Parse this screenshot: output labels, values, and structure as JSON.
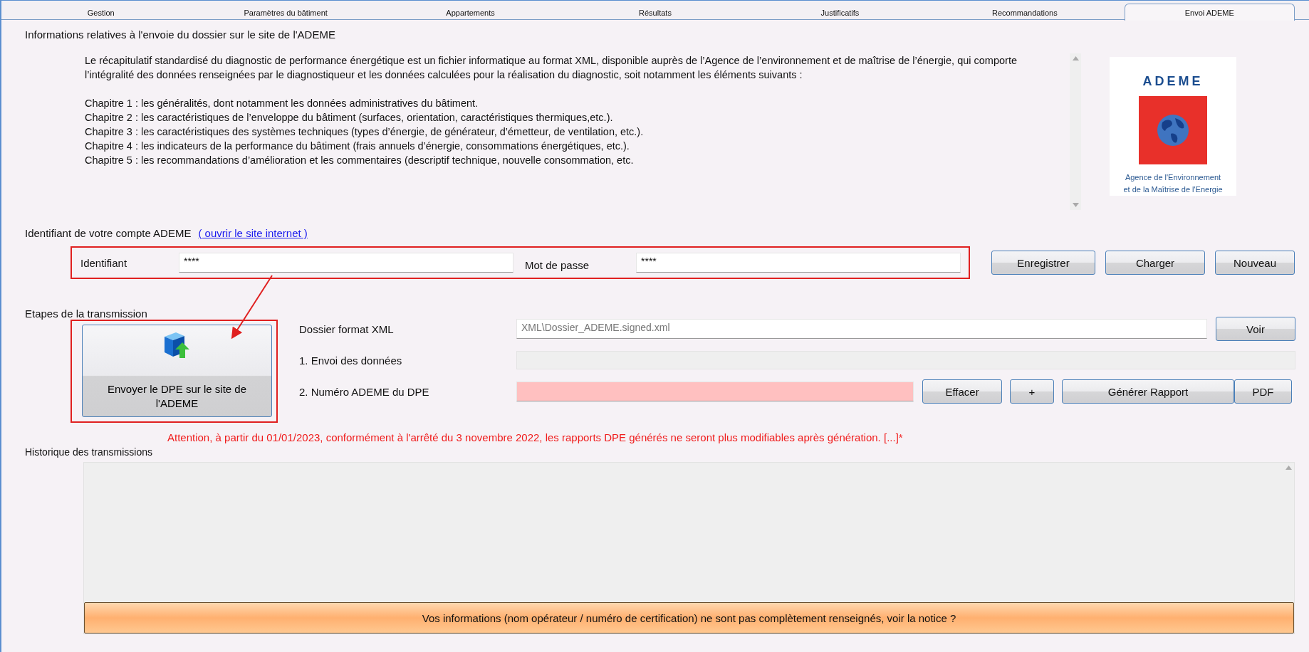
{
  "tabs": [
    {
      "label": "Gestion",
      "selected": false
    },
    {
      "label": "Paramètres du bâtiment",
      "selected": false
    },
    {
      "label": "Appartements",
      "selected": false
    },
    {
      "label": "Résultats",
      "selected": false
    },
    {
      "label": "Justificatifs",
      "selected": false
    },
    {
      "label": "Recommandations",
      "selected": false
    },
    {
      "label": "Envoi ADEME",
      "selected": true
    }
  ],
  "info": {
    "title": "Informations relatives à l'envoie du dossier sur le site de l'ADEME",
    "intro": "Le récapitulatif standardisé du diagnostic de performance énergétique est un fichier informatique au format XML, disponible auprès de l’Agence de l’environnement et de maîtrise de l’énergie, qui comporte l’intégralité des données renseignées par le diagnostiqueur et les données calculées pour la réalisation du diagnostic, soit notamment les éléments suivants :",
    "chapters": [
      "Chapitre 1 : les généralités, dont notamment les données administratives du bâtiment.",
      "Chapitre 2 : les caractéristiques de l’enveloppe du bâtiment (surfaces, orientation, caractéristiques thermiques,etc.).",
      "Chapitre 3 : les caractéristiques des systèmes techniques (types d’énergie, de générateur, d’émetteur, de ventilation, etc.).",
      "Chapitre 4 : les indicateurs de la performance du bâtiment (frais annuels d’énergie, consommations énergétiques, etc.).",
      "Chapitre 5 : les recommandations d’amélioration et les commentaires (descriptif technique, nouvelle consommation,  etc."
    ]
  },
  "logo": {
    "name": "ADEME",
    "caption": [
      "Agence de l'Environnement",
      "et de la Maîtrise de l'Energie"
    ]
  },
  "account": {
    "title": "Identifiant de votre compte ADEME",
    "link": "( ouvrir le site internet )",
    "fields": [
      {
        "label": "Identifiant",
        "value": "****"
      },
      {
        "label": "Mot de passe",
        "value": "****"
      }
    ],
    "buttons": [
      "Enregistrer",
      "Charger",
      "Nouveau"
    ]
  },
  "transmission": {
    "title": "Etapes de la transmission",
    "send_button": "Envoyer le DPE sur le site de l'ADEME",
    "rows": [
      {
        "kind": "file",
        "label": "Dossier format XML",
        "value": "XML\\Dossier_ADEME.signed.xml",
        "disabled": true,
        "buttons": [
          "Voir"
        ]
      },
      {
        "kind": "progress",
        "label": "1. Envoi des données",
        "level": 0
      },
      {
        "kind": "number",
        "label": "2. Numéro ADEME du DPE",
        "invalid": true,
        "buttons": [
          "Effacer",
          "+",
          "Générer Rapport",
          "PDF"
        ]
      }
    ]
  },
  "warning": "Attention, à partir du 01/01/2023, conformément à l'arrêté du 3 novembre 2022, les rapports DPE générés ne seront plus modifiables après génération. [...]*",
  "history": {
    "title": "Historique des transmissions"
  },
  "notice": "Vos informations (nom opérateur / numéro de certification) ne sont pas complètement renseignés, voir la notice ?"
}
